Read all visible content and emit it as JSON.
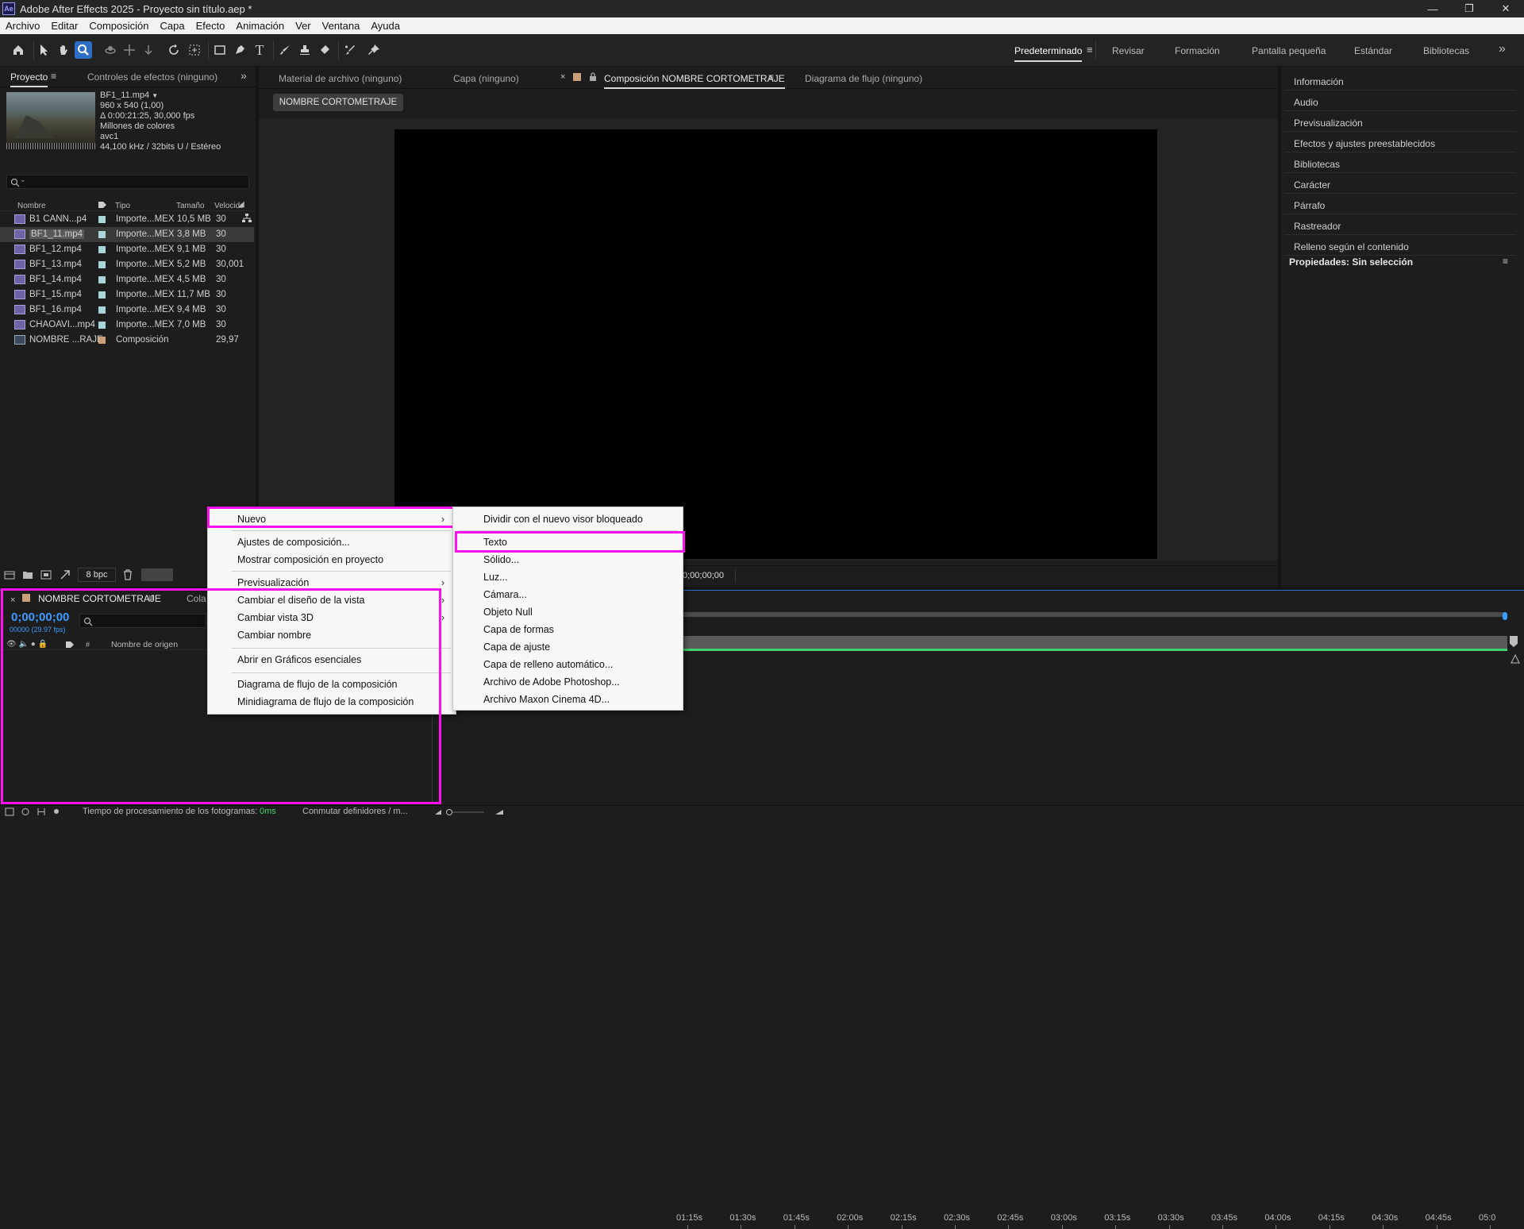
{
  "window": {
    "app_badge": "Ae",
    "title": "Adobe After Effects 2025 - Proyecto sin título.aep *",
    "controls": [
      "—",
      "❐",
      "✕"
    ]
  },
  "menubar": [
    "Archivo",
    "Editar",
    "Composición",
    "Capa",
    "Efecto",
    "Animación",
    "Ver",
    "Ventana",
    "Ayuda"
  ],
  "workspaces": {
    "items": [
      "Predeterminado",
      "Revisar",
      "Formación",
      "Pantalla pequeña",
      "Estándar",
      "Bibliotecas"
    ],
    "active": "Predeterminado",
    "overflow": "»"
  },
  "project_panel": {
    "tab_project": "Proyecto",
    "tab_effects": "Controles de efectos (ninguno)",
    "selected_file": {
      "name": "BF1_11.mp4",
      "resolution": "960 x 540 (1,00)",
      "duration": "Δ 0:00:21:25, 30,000 fps",
      "colors": "Millones de colores",
      "codec": "avc1",
      "audio": "44,100 kHz / 32bits U / Estéreo"
    },
    "search_placeholder": "",
    "columns": [
      "Nombre",
      "Tipo",
      "Tamaño",
      "Velocidad"
    ],
    "rows": [
      {
        "name": "B1 CANN...p4",
        "type": "Importe...MEX",
        "size": "10,5 MB",
        "fps": "30",
        "kind": "file",
        "label_color": "#a9d7d7"
      },
      {
        "name": "BF1_11.mp4",
        "type": "Importe...MEX",
        "size": "3,8 MB",
        "fps": "30",
        "kind": "file",
        "label_color": "#a9d7d7",
        "selected": true
      },
      {
        "name": "BF1_12.mp4",
        "type": "Importe...MEX",
        "size": "9,1 MB",
        "fps": "30",
        "kind": "file",
        "label_color": "#a9d7d7"
      },
      {
        "name": "BF1_13.mp4",
        "type": "Importe...MEX",
        "size": "5,2 MB",
        "fps": "30,001",
        "kind": "file",
        "label_color": "#a9d7d7"
      },
      {
        "name": "BF1_14.mp4",
        "type": "Importe...MEX",
        "size": "4,5 MB",
        "fps": "30",
        "kind": "file",
        "label_color": "#a9d7d7"
      },
      {
        "name": "BF1_15.mp4",
        "type": "Importe...MEX",
        "size": "11,7 MB",
        "fps": "30",
        "kind": "file",
        "label_color": "#a9d7d7"
      },
      {
        "name": "BF1_16.mp4",
        "type": "Importe...MEX",
        "size": "9,4 MB",
        "fps": "30",
        "kind": "file",
        "label_color": "#a9d7d7"
      },
      {
        "name": "CHAOAVI...mp4",
        "type": "Importe...MEX",
        "size": "7,0 MB",
        "fps": "30",
        "kind": "file",
        "label_color": "#a9d7d7"
      },
      {
        "name": "NOMBRE ...RAJE",
        "type": "Composición",
        "size": "",
        "fps": "29,97",
        "kind": "comp",
        "label_color": "#c9a07a"
      }
    ],
    "bpc": "8 bpc"
  },
  "viewer": {
    "tabs": [
      "Material de archivo (ninguno)",
      "Capa (ninguno)",
      "Composición NOMBRE CORTOMETRAJE",
      "Diagrama de flujo (ninguno)"
    ],
    "breadcrumb": "NOMBRE CORTOMETRAJE",
    "timecode": "0;00;00;00"
  },
  "right_panel": {
    "items": [
      "Información",
      "Audio",
      "Previsualización",
      "Efectos y ajustes preestablecidos",
      "Bibliotecas",
      "Carácter",
      "Párrafo",
      "Rastreador",
      "Relleno según el contenido"
    ],
    "properties": "Propiedades: Sin selección"
  },
  "timeline": {
    "tab": "NOMBRE CORTOMETRAJE",
    "tab2": "Cola",
    "timecode": "0;00;00;00",
    "fps_info": "00000 (29.97 fps)",
    "column_source": "Nombre de origen",
    "column_hash": "#",
    "ticks": [
      "01:15s",
      "01:30s",
      "01:45s",
      "02:00s",
      "02:15s",
      "02:30s",
      "02:45s",
      "03:00s",
      "03:15s",
      "03:30s",
      "03:45s",
      "04:00s",
      "04:15s",
      "04:30s",
      "04:45s",
      "05:0"
    ]
  },
  "statusbar": {
    "render_label": "Tiempo de procesamiento de los fotogramas:",
    "render_value": "0ms",
    "toggle": "Conmutar definidores / m..."
  },
  "context_menu": {
    "items": [
      {
        "label": "Nuevo",
        "submenu": true
      },
      {
        "label": "Ajustes de composición..."
      },
      {
        "label": "Mostrar composición en proyecto"
      },
      {
        "label": "Previsualización",
        "submenu": true
      },
      {
        "label": "Cambiar el diseño de la vista",
        "submenu": true
      },
      {
        "label": "Cambiar vista 3D",
        "submenu": true
      },
      {
        "label": "Cambiar nombre"
      },
      {
        "label": "Abrir en Gráficos esenciales"
      },
      {
        "label": "Diagrama de flujo de la composición"
      },
      {
        "label": "Minidiagrama de flujo de la composición"
      }
    ]
  },
  "submenu": {
    "items": [
      "Dividir con el nuevo visor bloqueado",
      "Texto",
      "Sólido...",
      "Luz...",
      "Cámara...",
      "Objeto Null",
      "Capa de formas",
      "Capa de ajuste",
      "Capa de relleno automático...",
      "Archivo de Adobe Photoshop...",
      "Archivo Maxon Cinema 4D..."
    ]
  },
  "colors": {
    "highlight": "#ff11ee",
    "accent_blue": "#2b6ec4",
    "timecode_blue": "#3d9bff",
    "status_green": "#3fd36b"
  },
  "icons": [
    "home-icon",
    "selection-arrow-icon",
    "hand-icon",
    "zoom-icon",
    "orbit-icon",
    "pan-icon",
    "dolly-icon",
    "rotate-icon",
    "pan-behind-icon",
    "rectangle-icon",
    "pen-icon",
    "text-icon",
    "brush-icon",
    "clone-stamp-icon",
    "eraser-icon",
    "roto-brush-icon",
    "puppet-pin-icon",
    "search-icon",
    "flowchart-icon",
    "label-icon",
    "trash-icon"
  ]
}
